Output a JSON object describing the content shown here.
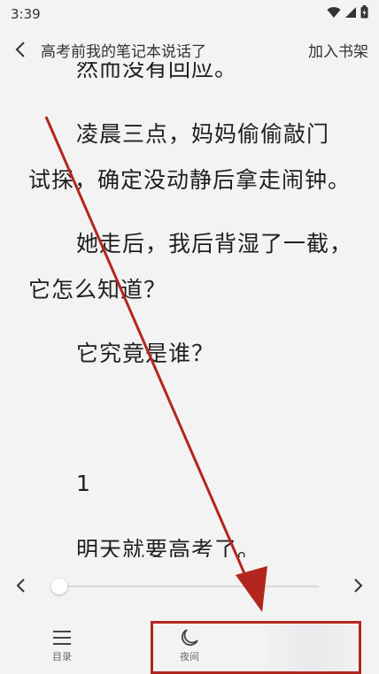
{
  "status_bar": {
    "time": "3:39",
    "icons": [
      "wifi-icon",
      "signal-icon",
      "battery-icon"
    ]
  },
  "header": {
    "title": "高考前我的笔记本说话了",
    "bookmark_label": "加入书架"
  },
  "content": {
    "paragraphs": [
      "然而没有回应。",
      "凌晨三点，妈妈偷偷敲门",
      "试探，确定没动静后拿走闹钟。",
      "她走后，我后背湿了一截，",
      "它怎么知道？",
      "它究竟是谁？",
      "1",
      "明天就要高考了。"
    ]
  },
  "progress": {
    "value_percent": 0
  },
  "tabs": [
    {
      "label": "目录",
      "icon": "menu-icon"
    },
    {
      "label": "夜间",
      "icon": "moon-icon"
    }
  ],
  "colors": {
    "annotation": "#b3261e",
    "background": "#f3f3f3"
  }
}
